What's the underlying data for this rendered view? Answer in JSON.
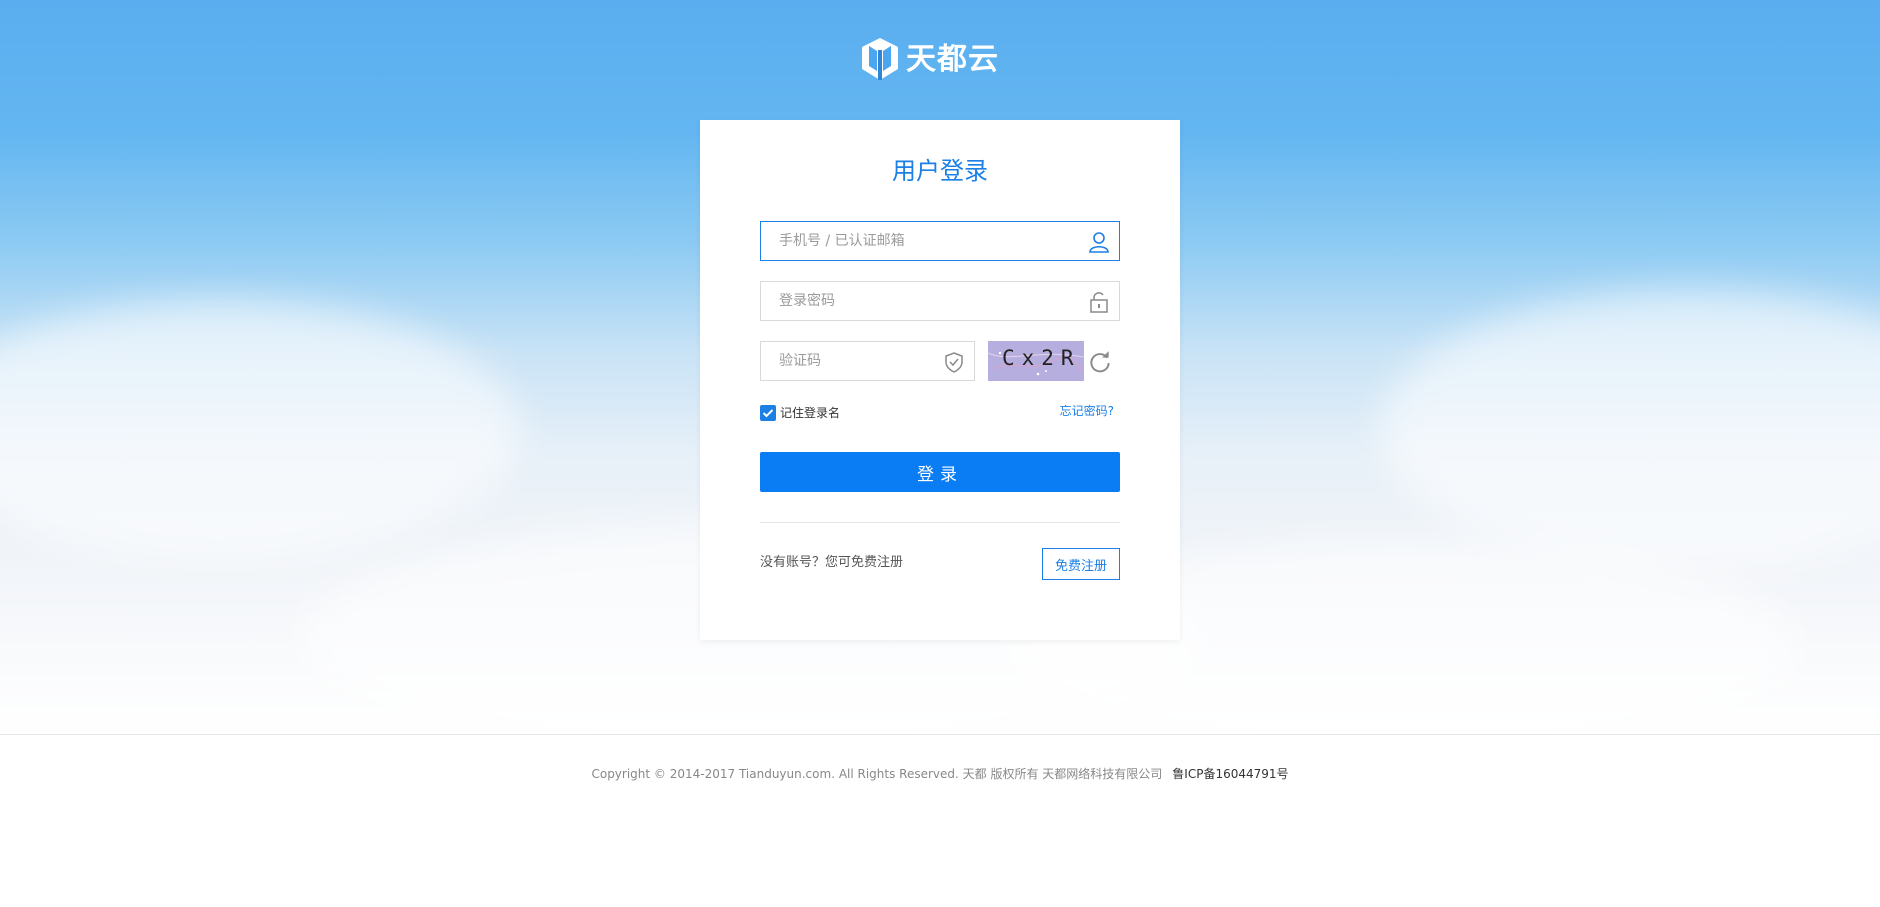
{
  "brand": {
    "name": "天都云",
    "icon": "tianduyun-logo-icon"
  },
  "login": {
    "title": "用户登录",
    "account_placeholder": "手机号 / 已认证邮箱",
    "password_placeholder": "登录密码",
    "captcha_placeholder": "验证码",
    "captcha_text": "Cx2R",
    "remember_label": "记住登录名",
    "remember_checked": true,
    "forgot_label": "忘记密码?",
    "submit_label": "登录",
    "no_account_text": "没有账号？您可免费注册",
    "register_label": "免费注册"
  },
  "footer": {
    "copyright": "Copyright © 2014-2017 Tianduyun.com. All Rights Reserved. 天都 版权所有    天都网络科技有限公司",
    "icp": "鲁ICP备16044791号"
  },
  "colors": {
    "accent": "#1b7fe6",
    "button": "#0a7df5"
  }
}
